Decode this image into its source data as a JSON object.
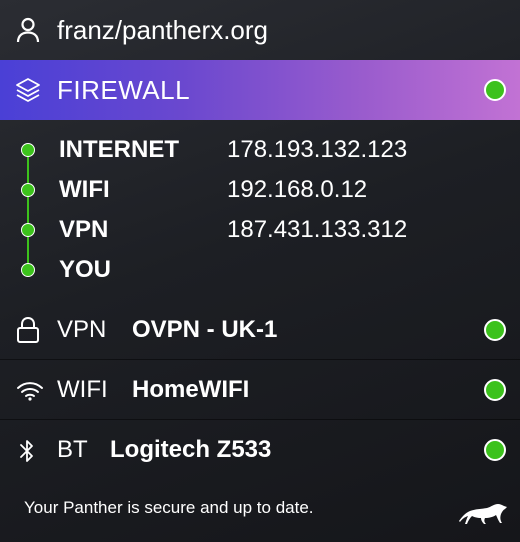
{
  "user": {
    "name": "franz/pantherx.org",
    "icon": "user-icon"
  },
  "firewall": {
    "label": "FIREWALL",
    "icon": "layers-icon",
    "status": "active",
    "gradient": [
      "#4a40d6",
      "#c272d4"
    ]
  },
  "route": {
    "hops": [
      {
        "label": "INTERNET",
        "ip": "178.193.132.123"
      },
      {
        "label": "WIFI",
        "ip": "192.168.0.12"
      },
      {
        "label": "VPN",
        "ip": "187.431.133.312"
      },
      {
        "label": "YOU",
        "ip": ""
      }
    ]
  },
  "connections": [
    {
      "type": "VPN",
      "value": "OVPN - UK-1",
      "icon": "lock-icon",
      "status": "active"
    },
    {
      "type": "WIFI",
      "value": "HomeWIFI",
      "icon": "wifi-icon",
      "status": "active"
    },
    {
      "type": "BT",
      "value": "Logitech Z533",
      "icon": "bluetooth-icon",
      "status": "active"
    }
  ],
  "footer": {
    "message": "Your Panther is secure and up to date.",
    "logo": "panther-logo"
  },
  "colors": {
    "status_ok": "#3cc21c",
    "background": "#1d1f24",
    "text": "#ffffff"
  }
}
